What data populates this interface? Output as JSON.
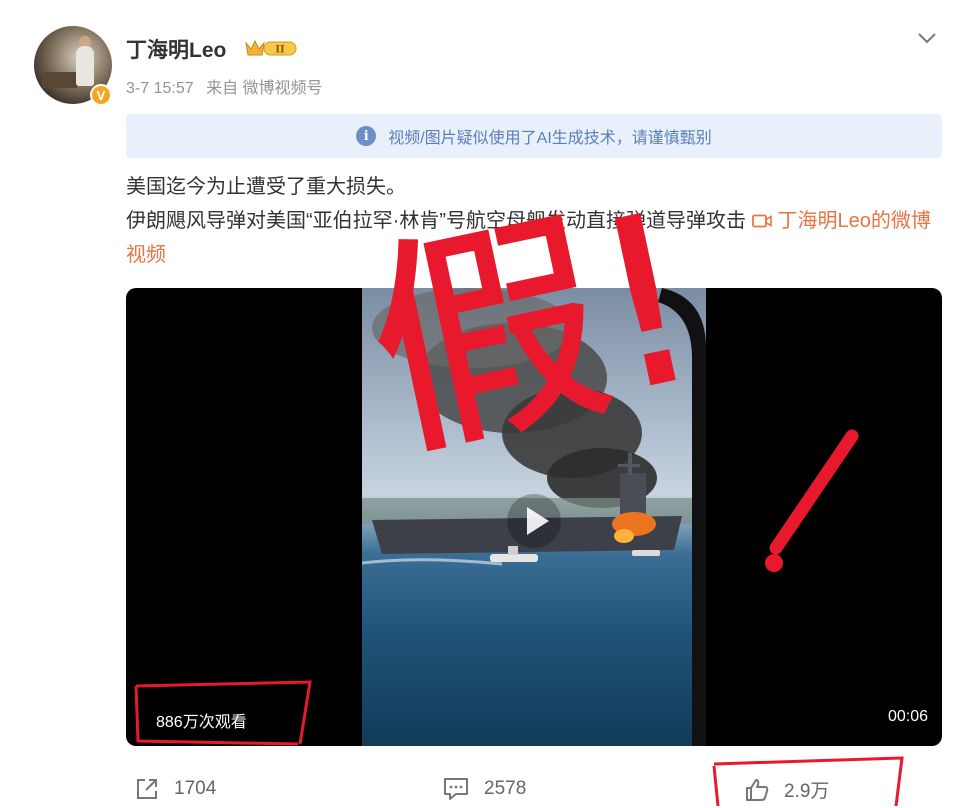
{
  "user": {
    "name": "丁海明Leo",
    "verified_badge": "V",
    "level_badge": "II"
  },
  "post_meta": {
    "time": "3-7 15:57",
    "source": "来自 微博视频号"
  },
  "notice": {
    "icon": "info-icon",
    "text": "视频/图片疑似使用了AI生成技术，请谨慎甄别"
  },
  "post": {
    "line1": "美国迄今为止遭受了重大损失。",
    "line2": "伊朗飓风导弹对美国“亚伯拉罕·林肯”号航空母舰发动直接弹道导弹攻击",
    "video_link": "丁海明Leo的微博视频"
  },
  "video": {
    "views": "886万次观看",
    "duration": "00:06"
  },
  "annotation": {
    "stamp_text": "假!",
    "extra_mark": "!",
    "color": "#e8192c"
  },
  "actions": {
    "share_count": "1704",
    "comment_count": "2578",
    "like_count": "2.9万"
  },
  "colors": {
    "link": "#eb7340",
    "notice_bg": "#e8f0fb",
    "notice_text": "#5a7fb8",
    "badge": "#f6a623"
  }
}
